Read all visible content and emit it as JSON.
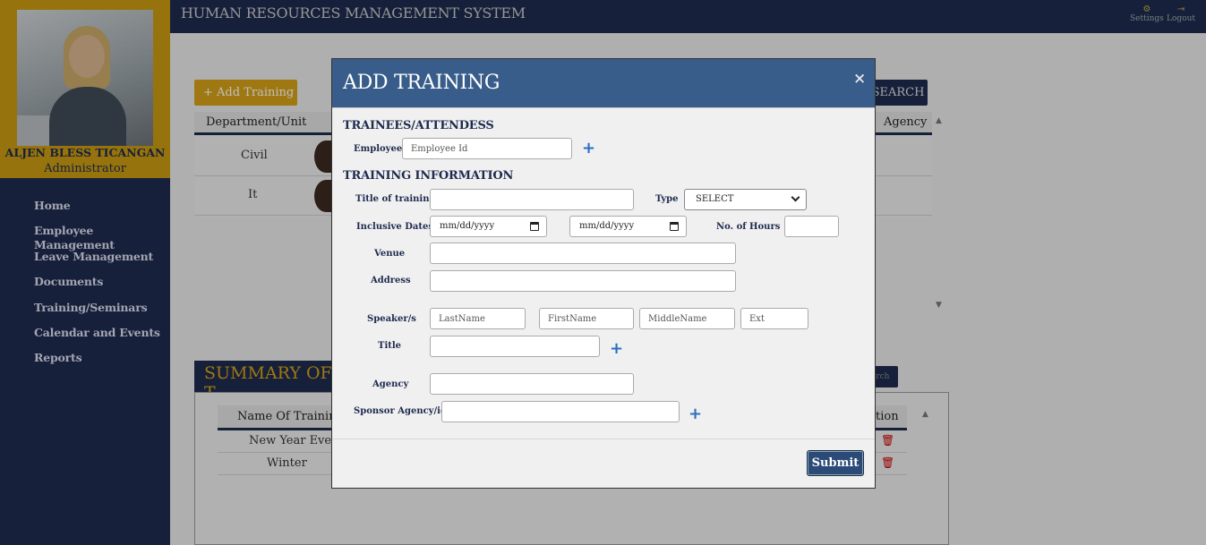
{
  "app": {
    "title": "HUMAN RESOURCES MANAGEMENT SYSTEM"
  },
  "topbar": {
    "settings_label": "Settings",
    "logout_label": "Logout",
    "settings_icon": "gear-icon",
    "logout_icon": "logout-icon"
  },
  "profile": {
    "name": "ALJEN BLESS TICANGAN",
    "role": "Administrator"
  },
  "sidebar": {
    "items": [
      {
        "label": "Home"
      },
      {
        "label": "Employee Management"
      },
      {
        "label": "Leave Management"
      },
      {
        "label": "Documents"
      },
      {
        "label": "Training/Seminars"
      },
      {
        "label": "Calendar and Events"
      },
      {
        "label": "Reports"
      }
    ]
  },
  "main": {
    "add_button": "Add Training",
    "search_button": "SEARCH",
    "columns": [
      "Department/Unit",
      "Agency"
    ],
    "rows": [
      {
        "department": "Civil"
      },
      {
        "department": "It"
      }
    ],
    "summary_title": "SUMMARY OF T",
    "summary_search": "earch",
    "summary_columns": [
      "Name Of Training",
      "tion"
    ],
    "summary_rows": [
      {
        "name": "New Year Eve"
      },
      {
        "name": "Winter"
      }
    ]
  },
  "modal": {
    "title": "ADD TRAINING",
    "close": "×",
    "section_trainees": "TRAINEES/ATTENDESS",
    "employee_label": "Employee",
    "employee_placeholder": "Employee Id",
    "section_info": "TRAINING INFORMATION",
    "title_label": "Title of training",
    "type_label": "Type",
    "type_value": "SELECT",
    "dates_label": "Inclusive Dates",
    "date_placeholder": "mm/dd/yyyy",
    "hours_label": "No. of Hours",
    "venue_label": "Venue",
    "address_label": "Address",
    "speakers_label": "Speaker/s",
    "lastname_placeholder": "LastName",
    "firstname_placeholder": "FirstName",
    "middlename_placeholder": "MiddleName",
    "ext_placeholder": "Ext",
    "speaker_title_label": "Title",
    "agency_label": "Agency",
    "sponsor_label": "Sponsor Agency/ies",
    "submit_label": "Submit"
  }
}
